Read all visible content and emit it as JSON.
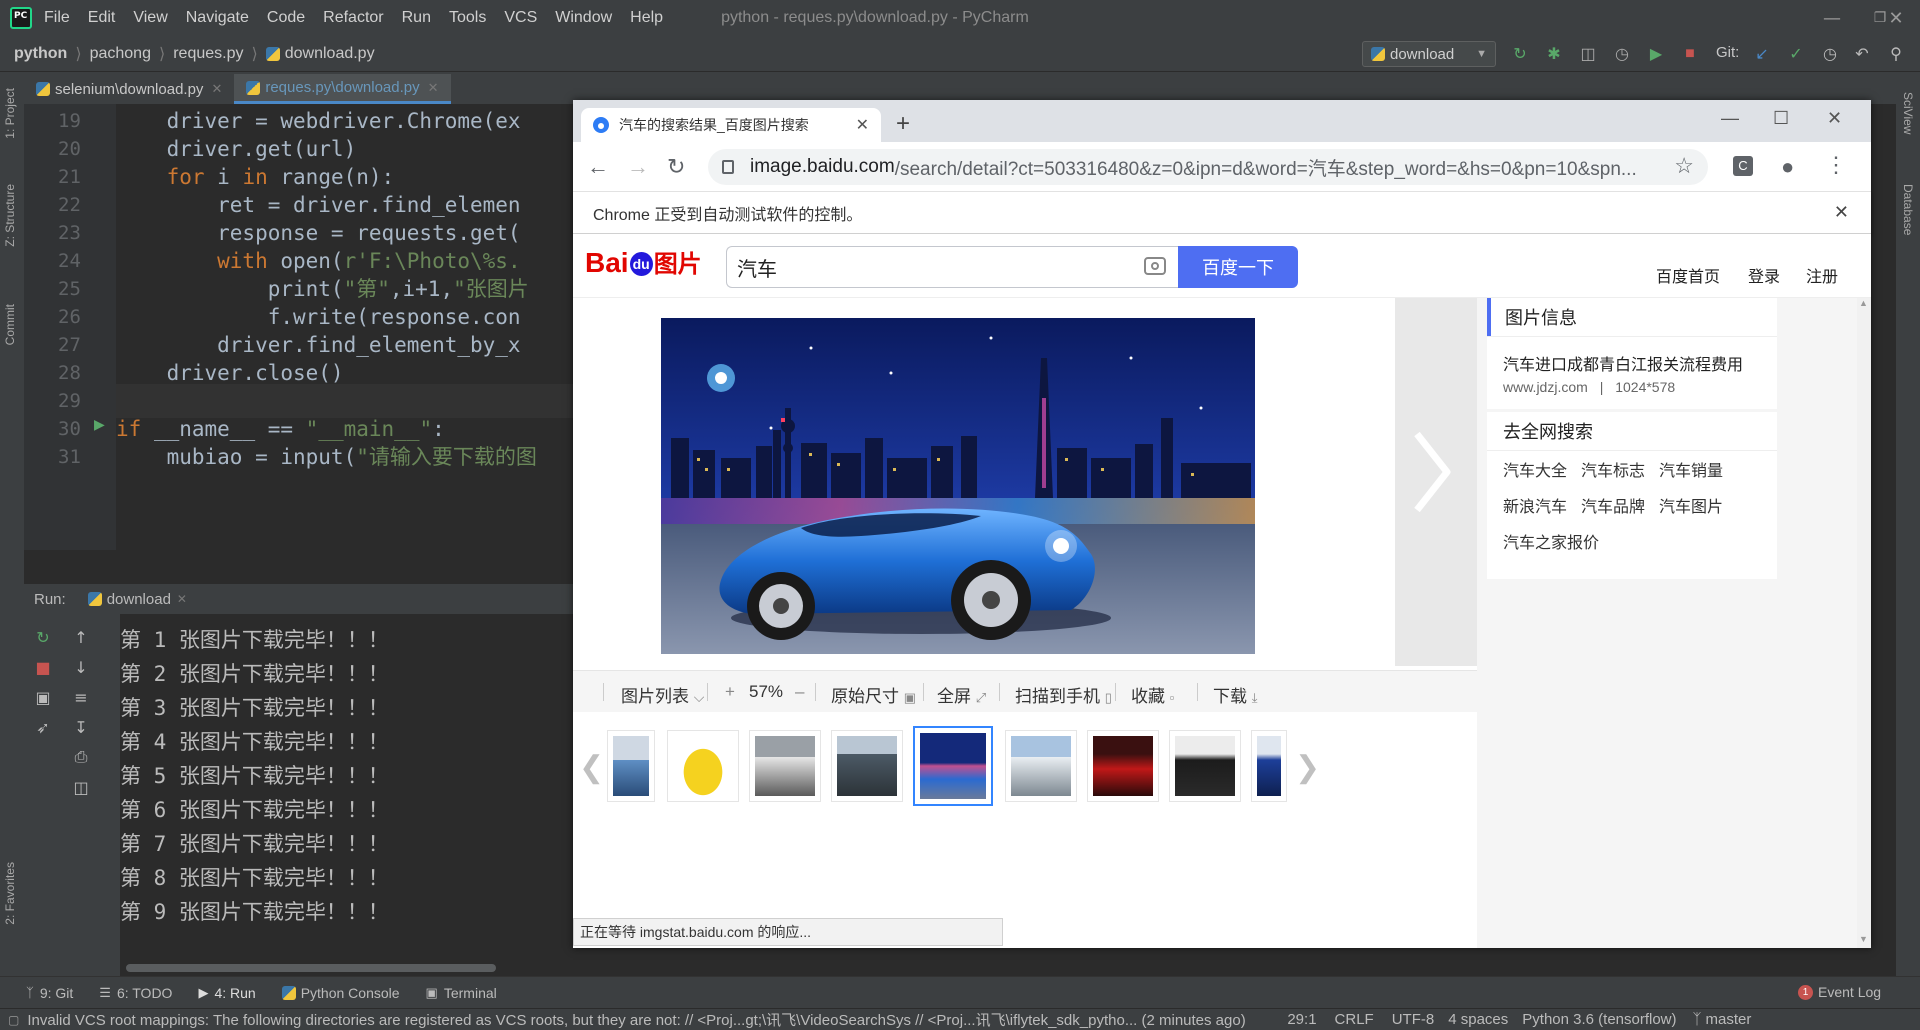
{
  "ide": {
    "menu": [
      "File",
      "Edit",
      "View",
      "Navigate",
      "Code",
      "Refactor",
      "Run",
      "Tools",
      "VCS",
      "Window",
      "Help"
    ],
    "window_title": "python - reques.py\\download.py - PyCharm",
    "breadcrumb": [
      "python",
      "pachong",
      "reques.py",
      "download.py"
    ],
    "run_config": "download",
    "git_label": "Git:",
    "editor_tabs": [
      {
        "label": "selenium\\download.py",
        "active": false
      },
      {
        "label": "reques.py\\download.py",
        "active": true
      }
    ],
    "left_tools": [
      "1: Project",
      "Z: Structure",
      "Commit",
      "2: Favorites"
    ],
    "right_tools": [
      "SciView",
      "Database"
    ],
    "code_lines": [
      {
        "num": "19",
        "text": "    driver = webdriver.Chrome(ex"
      },
      {
        "num": "20",
        "text": "    driver.get(url)"
      },
      {
        "num": "21",
        "text": "    for i in range(n):"
      },
      {
        "num": "22",
        "text": "        ret = driver.find_elemen"
      },
      {
        "num": "23",
        "text": "        response = requests.get("
      },
      {
        "num": "24",
        "text": "        with open(r'F:\\Photo\\%s."
      },
      {
        "num": "25",
        "text": "            print(\"第\",i+1,\"张图片"
      },
      {
        "num": "26",
        "text": "            f.write(response.con"
      },
      {
        "num": "27",
        "text": "        driver.find_element_by_x"
      },
      {
        "num": "28",
        "text": "    driver.close()"
      },
      {
        "num": "29",
        "text": ""
      },
      {
        "num": "30",
        "text": "if __name__ == \"__main__\":"
      },
      {
        "num": "31",
        "text": "    mubiao = input(\"请输入要下载的图"
      }
    ],
    "run_label": "Run:",
    "run_tab": "download",
    "console_lines": [
      "第 1 张图片下载完毕！！！",
      "第 2 张图片下载完毕！！！",
      "第 3 张图片下载完毕！！！",
      "第 4 张图片下载完毕！！！",
      "第 5 张图片下载完毕！！！",
      "第 6 张图片下载完毕！！！",
      "第 7 张图片下载完毕！！！",
      "第 8 张图片下载完毕！！！",
      "第 9 张图片下载完毕！！！"
    ],
    "bottom_tabs": [
      "9: Git",
      "6: TODO",
      "4: Run",
      "Python Console",
      "Terminal"
    ],
    "event_log": "Event Log",
    "event_count": "1",
    "status_message": "Invalid VCS root mappings: The following directories are registered as VCS roots, but they are not: // <Proj...gt;\\讯飞\\VideoSearchSys // <Proj...讯飞\\iflytek_sdk_pytho... (2 minutes ago)",
    "status_items": [
      "29:1",
      "CRLF",
      "UTF-8",
      "4 spaces",
      "Python 3.6 (tensorflow)",
      "master"
    ]
  },
  "browser": {
    "tab_title": "汽车的搜索结果_百度图片搜索",
    "url_host": "image.baidu.com",
    "url_path": "/search/detail?ct=503316480&z=0&ipn=d&word=汽车&step_word=&hs=0&pn=10&spn...",
    "automation_notice": "Chrome 正受到自动测试软件的控制。",
    "status_text": "正在等待 imgstat.baidu.com 的响应...",
    "baidu": {
      "logo_bai": "Bai",
      "logo_du": "du",
      "logo_tupian": "图片",
      "search_value": "汽车",
      "search_button": "百度一下",
      "header_links": [
        "百度首页",
        "登录",
        "注册"
      ],
      "viewer_tools": {
        "list": "图片列表",
        "plus": "+",
        "zoom": "57%",
        "minus": "–",
        "original": "原始尺寸",
        "fullscreen": "全屏",
        "scan": "扫描到手机",
        "favorite": "收藏",
        "download": "下载"
      },
      "info_card_title": "图片信息",
      "info_title": "汽车进口成都青白江报关流程费用",
      "info_source": "www.jdzj.com",
      "info_size": "1024*578",
      "search_card_title": "去全网搜索",
      "related": [
        "汽车大全",
        "汽车标志",
        "汽车销量",
        "新浪汽车",
        "汽车品牌",
        "汽车图片",
        "汽车之家报价"
      ]
    }
  },
  "colors": {
    "ide_bg": "#2b2b2b",
    "ide_panel": "#3c3f41",
    "keyword": "#cc7832",
    "string": "#6a8759",
    "baidu_blue": "#4e6ef2",
    "baidu_red": "#e10601"
  }
}
